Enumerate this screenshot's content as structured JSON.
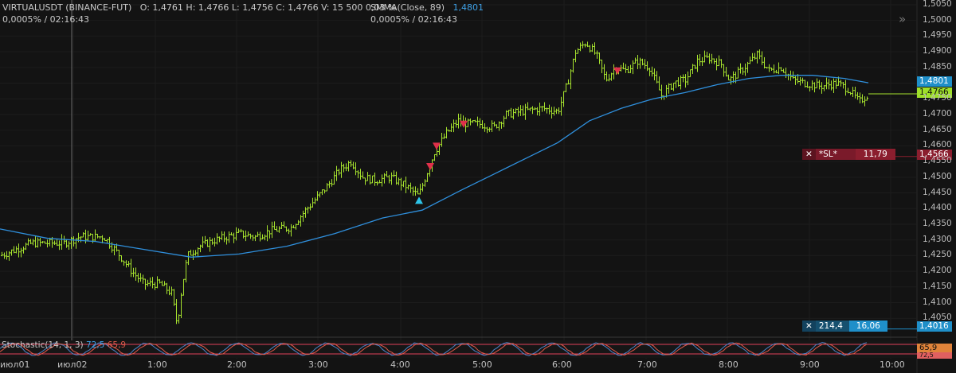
{
  "header": {
    "symbol": "VIRTUALUSDT (BINANCE-FUT)",
    "ohlc": "O: 1,4761  H: 1,4766  L: 1,4756  C: 1,4766  V: 15 500  0,03 %",
    "change_time_1": "0,0005% / 02:16:43",
    "smma_label": "SMMA(Close, 89)",
    "smma_value": "1,4801",
    "change_time_2": "0,0005% / 02:16:43"
  },
  "price_tags": {
    "smma": "1,4801",
    "last": "1,4766",
    "sl_line": "1,4566",
    "order_line": "1,4016",
    "stoch_k": "72,5",
    "stoch_d": "65,9"
  },
  "orders": {
    "sl": {
      "label": "*SL*",
      "value": "11,79",
      "close_icon": "✕"
    },
    "limit": {
      "qty": "214,4",
      "value": "16,06",
      "close_icon": "✕"
    }
  },
  "stochastic": {
    "label": "Stochastic(14, 1, 3)",
    "k": "72,5",
    "d": "65,9",
    "upper_level": "80,0",
    "lower_level": "20,0"
  },
  "y_axis": [
    "1,5050",
    "1,5000",
    "1,4950",
    "1,4900",
    "1,4850",
    "1,4750",
    "1,4700",
    "1,4650",
    "1,4600",
    "1,4550",
    "1,4500",
    "1,4450",
    "1,4400",
    "1,4350",
    "1,4300",
    "1,4250",
    "1,4200",
    "1,4150",
    "1,4100",
    "1,4050"
  ],
  "x_axis": [
    "июл01",
    "июл02",
    "1:00",
    "2:00",
    "3:00",
    "4:00",
    "5:00",
    "6:00",
    "7:00",
    "8:00",
    "9:00",
    "10:00"
  ],
  "colors": {
    "background": "#131313",
    "bar": "#a6e22e",
    "smma": "#2f8fdc",
    "sl": "#8b1e2e",
    "order_blue": "#1f8fc9",
    "stoch_k": "#4a82c8",
    "stoch_d": "#e05a4a"
  },
  "icons": {
    "collapse": "chevron-double-right-icon"
  },
  "chart_data": {
    "type": "ohlc",
    "y_range": [
      1.401,
      1.5055
    ],
    "price_points": [
      [
        0,
        1.425
      ],
      [
        40,
        1.429
      ],
      [
        80,
        1.429
      ],
      [
        100,
        1.431
      ],
      [
        130,
        1.431
      ],
      [
        150,
        1.425
      ],
      [
        165,
        1.42
      ],
      [
        180,
        1.416
      ],
      [
        200,
        1.416
      ],
      [
        215,
        1.413
      ],
      [
        222,
        1.403
      ],
      [
        228,
        1.415
      ],
      [
        235,
        1.425
      ],
      [
        250,
        1.428
      ],
      [
        270,
        1.43
      ],
      [
        300,
        1.432
      ],
      [
        320,
        1.431
      ],
      [
        340,
        1.433
      ],
      [
        365,
        1.434
      ],
      [
        385,
        1.44
      ],
      [
        410,
        1.447
      ],
      [
        425,
        1.452
      ],
      [
        440,
        1.455
      ],
      [
        455,
        1.45
      ],
      [
        470,
        1.449
      ],
      [
        490,
        1.45
      ],
      [
        510,
        1.447
      ],
      [
        525,
        1.444
      ],
      [
        535,
        1.451
      ],
      [
        545,
        1.458
      ],
      [
        560,
        1.464
      ],
      [
        575,
        1.468
      ],
      [
        585,
        1.467
      ],
      [
        600,
        1.467
      ],
      [
        620,
        1.466
      ],
      [
        635,
        1.47
      ],
      [
        655,
        1.471
      ],
      [
        680,
        1.472
      ],
      [
        700,
        1.471
      ],
      [
        712,
        1.48
      ],
      [
        722,
        1.49
      ],
      [
        735,
        1.493
      ],
      [
        748,
        1.489
      ],
      [
        760,
        1.481
      ],
      [
        772,
        1.485
      ],
      [
        785,
        1.484
      ],
      [
        800,
        1.487
      ],
      [
        815,
        1.485
      ],
      [
        830,
        1.476
      ],
      [
        845,
        1.48
      ],
      [
        860,
        1.481
      ],
      [
        875,
        1.487
      ],
      [
        890,
        1.488
      ],
      [
        905,
        1.486
      ],
      [
        915,
        1.481
      ],
      [
        930,
        1.484
      ],
      [
        950,
        1.489
      ],
      [
        965,
        1.484
      ],
      [
        980,
        1.485
      ],
      [
        995,
        1.481
      ],
      [
        1010,
        1.48
      ],
      [
        1030,
        1.479
      ],
      [
        1050,
        1.48
      ],
      [
        1065,
        1.478
      ],
      [
        1078,
        1.474
      ],
      [
        1090,
        1.4766
      ]
    ],
    "smma_points": [
      [
        0,
        1.4335
      ],
      [
        60,
        1.4305
      ],
      [
        120,
        1.4295
      ],
      [
        180,
        1.427
      ],
      [
        240,
        1.4245
      ],
      [
        300,
        1.4255
      ],
      [
        360,
        1.428
      ],
      [
        420,
        1.432
      ],
      [
        480,
        1.437
      ],
      [
        530,
        1.4395
      ],
      [
        580,
        1.446
      ],
      [
        620,
        1.451
      ],
      [
        660,
        1.456
      ],
      [
        700,
        1.461
      ],
      [
        740,
        1.468
      ],
      [
        780,
        1.472
      ],
      [
        820,
        1.475
      ],
      [
        860,
        1.477
      ],
      [
        900,
        1.4795
      ],
      [
        940,
        1.4815
      ],
      [
        980,
        1.4825
      ],
      [
        1020,
        1.4825
      ],
      [
        1060,
        1.4815
      ],
      [
        1090,
        1.4801
      ]
    ],
    "markers": [
      {
        "type": "buy",
        "x": "4:10",
        "price": 1.4425
      },
      {
        "type": "sell",
        "x": "4:15",
        "price": 1.4535
      },
      {
        "type": "sell",
        "x": "4:20",
        "price": 1.46
      },
      {
        "type": "sell",
        "x": "4:35",
        "price": 1.467
      },
      {
        "type": "sell",
        "x": "7:40",
        "price": 1.484
      }
    ]
  }
}
